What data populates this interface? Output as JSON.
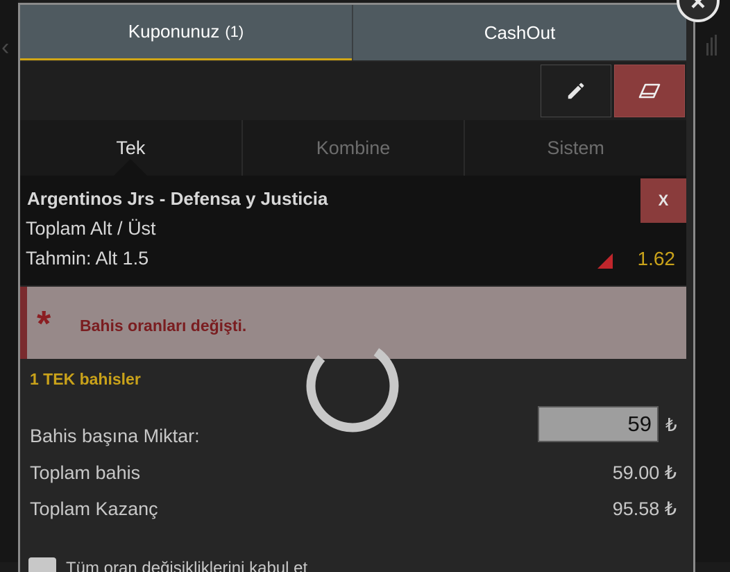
{
  "tabs": {
    "coupon_label": "Kuponunuz",
    "coupon_count": "(1)",
    "cashout_label": "CashOut"
  },
  "toolbar": {
    "edit_icon": "pencil-icon",
    "clear_icon": "eraser-icon"
  },
  "bet_types": [
    {
      "label": "Tek",
      "active": true
    },
    {
      "label": "Kombine",
      "active": false
    },
    {
      "label": "Sistem",
      "active": false
    }
  ],
  "bet": {
    "match": "Argentinos Jrs - Defensa y Justicia",
    "market": "Toplam Alt / Üst",
    "pick": "Tahmin: Alt 1.5",
    "odds": "1.62",
    "remove_label": "X"
  },
  "alert": {
    "icon": "asterisk-icon",
    "message": "Bahis oranları değişti."
  },
  "summary": {
    "single_bets_label": "1 TEK bahisler",
    "stake_label": "Bahis başına Miktar:",
    "stake_value": "59",
    "currency": "₺",
    "total_stake_label": "Toplam bahis",
    "total_stake_value": "59.00 ₺",
    "total_win_label": "Toplam Kazanç",
    "total_win_value": "95.58 ₺",
    "accept_changes_label": "Tüm oran değişikliklerini kabul et"
  },
  "colors": {
    "accent": "#d1a615",
    "danger": "#8a3c3c",
    "odds_down": "#c0262c"
  }
}
